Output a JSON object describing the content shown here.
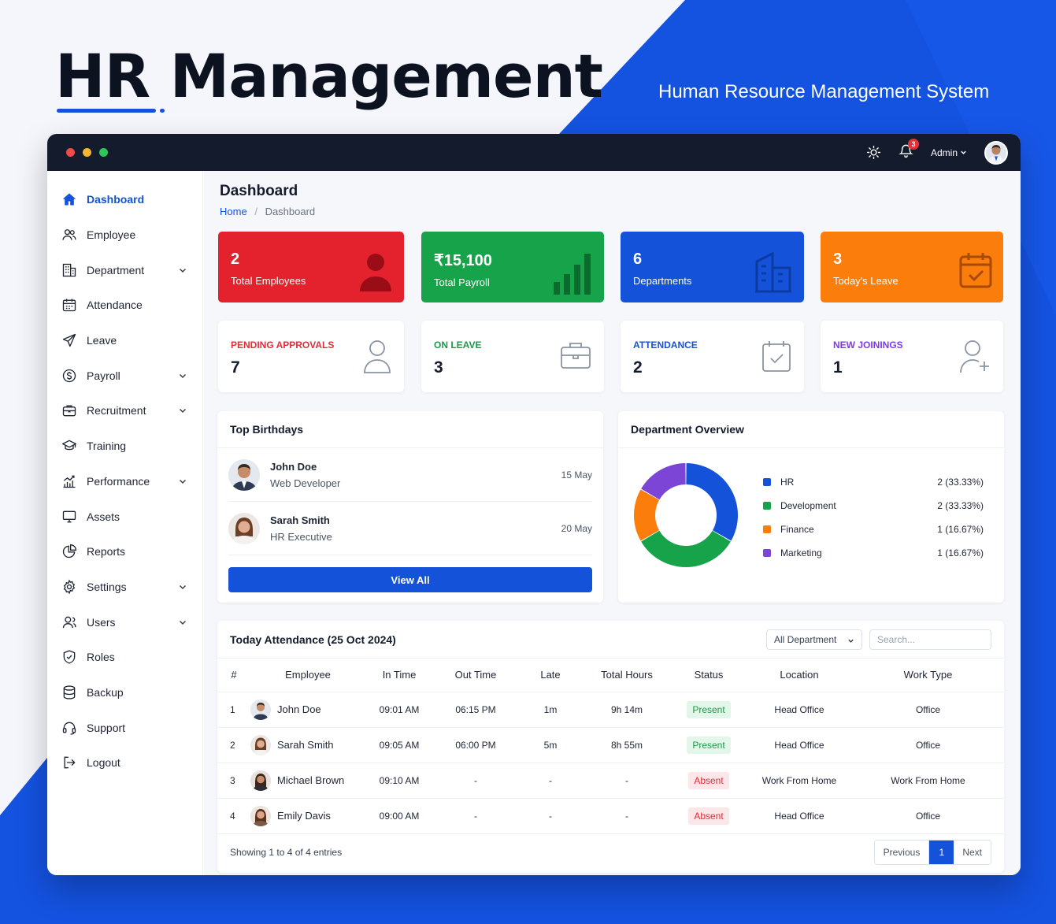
{
  "hero": {
    "title": "HR Management",
    "subtitle": "Human Resource Management System"
  },
  "topbar": {
    "notification_count": "3",
    "user_label": "Admin"
  },
  "sidebar": {
    "items": [
      {
        "label": "Dashboard",
        "icon": "home-icon",
        "active": true
      },
      {
        "label": "Employee",
        "icon": "users-icon"
      },
      {
        "label": "Department",
        "icon": "building-icon",
        "expandable": true
      },
      {
        "label": "Attendance",
        "icon": "calendar-icon"
      },
      {
        "label": "Leave",
        "icon": "paper-plane-icon"
      },
      {
        "label": "Payroll",
        "icon": "dollar-icon",
        "expandable": true
      },
      {
        "label": "Recruitment",
        "icon": "briefcase-icon",
        "expandable": true
      },
      {
        "label": "Training",
        "icon": "graduation-cap-icon"
      },
      {
        "label": "Performance",
        "icon": "bar-chart-icon",
        "expandable": true
      },
      {
        "label": "Assets",
        "icon": "monitor-icon"
      },
      {
        "label": "Reports",
        "icon": "pie-chart-icon"
      },
      {
        "label": "Settings",
        "icon": "gear-icon",
        "expandable": true
      },
      {
        "label": "Users",
        "icon": "user-icon",
        "expandable": true
      },
      {
        "label": "Roles",
        "icon": "shield-icon"
      },
      {
        "label": "Backup",
        "icon": "database-icon"
      },
      {
        "label": "Support",
        "icon": "headset-icon"
      },
      {
        "label": "Logout",
        "icon": "logout-icon"
      }
    ]
  },
  "page": {
    "title": "Dashboard",
    "breadcrumb": {
      "home": "Home",
      "current": "Dashboard"
    }
  },
  "stats": [
    {
      "value": "2",
      "label": "Total Employees",
      "color": "#e3222e"
    },
    {
      "value": "₹15,100",
      "label": "Total Payroll",
      "color": "#17a34a"
    },
    {
      "value": "6",
      "label": "Departments",
      "color": "#1452d9"
    },
    {
      "value": "3",
      "label": "Today's Leave",
      "color": "#fb7d0c"
    }
  ],
  "mini_stats": [
    {
      "label": "PENDING APPROVALS",
      "value": "7",
      "color": "#de2f3b"
    },
    {
      "label": "ON LEAVE",
      "value": "3",
      "color": "#1a9a4b"
    },
    {
      "label": "ATTENDANCE",
      "value": "2",
      "color": "#1452d9"
    },
    {
      "label": "NEW JOININGS",
      "value": "1",
      "color": "#7c3aed"
    }
  ],
  "birthdays": {
    "title": "Top Birthdays",
    "people": [
      {
        "name": "John Doe",
        "role": "Web Developer",
        "date": "15 May"
      },
      {
        "name": "Sarah Smith",
        "role": "HR Executive",
        "date": "20 May"
      }
    ],
    "view_all": "View All"
  },
  "department_overview": {
    "title": "Department Overview"
  },
  "chart_data": {
    "type": "pie",
    "categories": [
      "HR",
      "Development",
      "Finance",
      "Marketing"
    ],
    "values": [
      2,
      2,
      1,
      1
    ],
    "labels": [
      "2 (33.33%)",
      "2 (33.33%)",
      "1 (16.67%)",
      "1 (16.67%)"
    ],
    "colors": [
      "#1452d9",
      "#17a34a",
      "#fb7d0c",
      "#7c45d6"
    ],
    "title": "Department Overview",
    "legend": "right"
  },
  "attendance": {
    "title": "Today Attendance (25 Oct 2024)",
    "filter_value": "All Department",
    "search_placeholder": "Search...",
    "columns": [
      "#",
      "Employee",
      "In Time",
      "Out Time",
      "Late",
      "Total Hours",
      "Status",
      "Location",
      "Work Type"
    ],
    "rows": [
      {
        "no": "1",
        "name": "John Doe",
        "in": "09:01 AM",
        "out": "06:15 PM",
        "late": "1m",
        "hours": "9h 14m",
        "status": "Present",
        "location": "Head Office",
        "type": "Office"
      },
      {
        "no": "2",
        "name": "Sarah Smith",
        "in": "09:05 AM",
        "out": "06:00 PM",
        "late": "5m",
        "hours": "8h 55m",
        "status": "Present",
        "location": "Head Office",
        "type": "Office"
      },
      {
        "no": "3",
        "name": "Michael Brown",
        "in": "09:10 AM",
        "out": "-",
        "late": "-",
        "hours": "-",
        "status": "Absent",
        "location": "Work From Home",
        "type": "Work From Home"
      },
      {
        "no": "4",
        "name": "Emily Davis",
        "in": "09:00 AM",
        "out": "-",
        "late": "-",
        "hours": "-",
        "status": "Absent",
        "location": "Head Office",
        "type": "Office"
      }
    ],
    "footer": "Showing 1 to 4 of 4 entries",
    "pagination": {
      "prev": "Previous",
      "page": "1",
      "next": "Next"
    }
  }
}
